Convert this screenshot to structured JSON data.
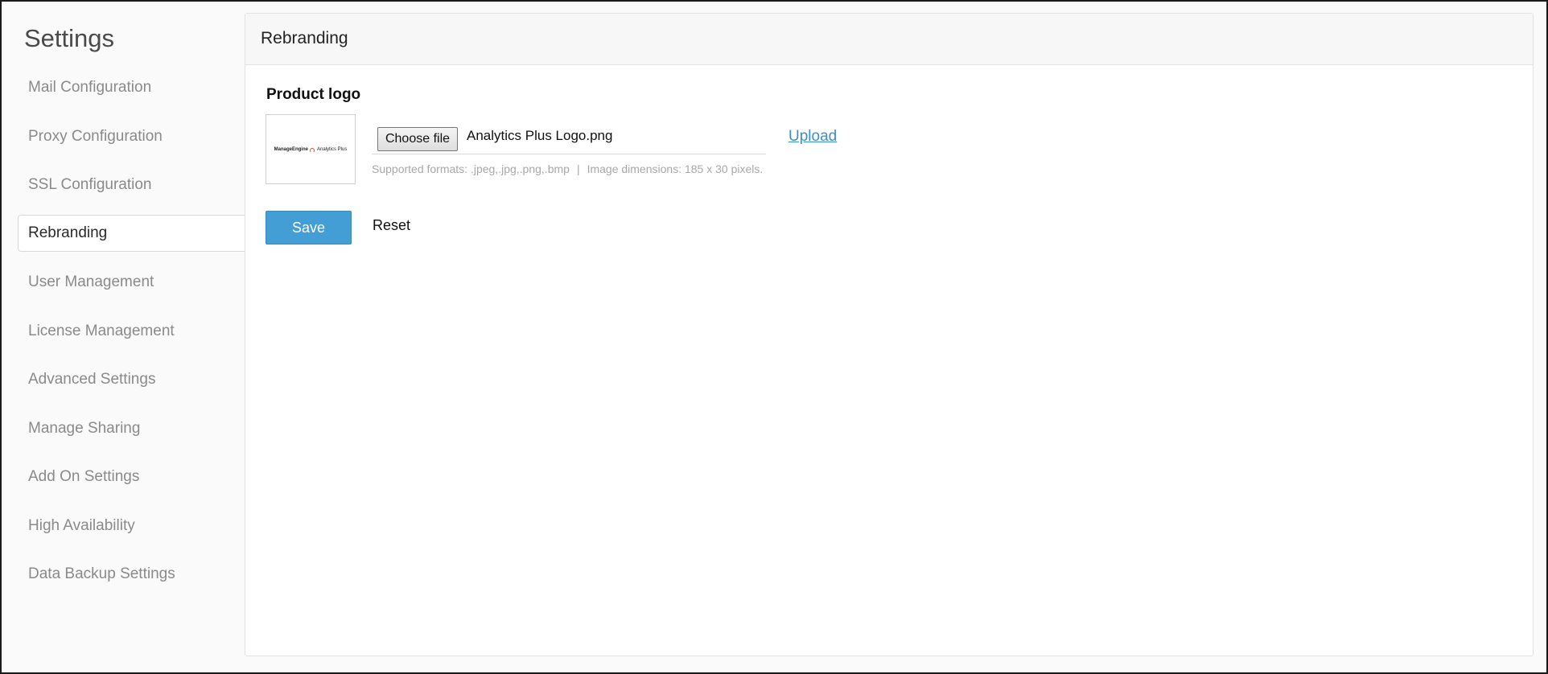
{
  "sidebar": {
    "title": "Settings",
    "items": [
      {
        "label": "Mail Configuration"
      },
      {
        "label": "Proxy Configuration"
      },
      {
        "label": "SSL Configuration"
      },
      {
        "label": "Rebranding",
        "active": true
      },
      {
        "label": "User Management"
      },
      {
        "label": "License Management"
      },
      {
        "label": "Advanced Settings"
      },
      {
        "label": "Manage Sharing"
      },
      {
        "label": "Add On Settings"
      },
      {
        "label": "High Availability"
      },
      {
        "label": "Data Backup Settings"
      }
    ]
  },
  "main": {
    "title": "Rebranding",
    "product_logo": {
      "label": "Product logo",
      "preview": {
        "brand": "ManageEngine",
        "product": "Analytics Plus"
      },
      "choose_file_label": "Choose file",
      "file_name": "Analytics Plus Logo.png",
      "upload_label": "Upload",
      "supported_formats": "Supported formats: .jpeg,.jpg,.png,.bmp",
      "separator": "|",
      "image_dimensions": "Image dimensions: 185 x 30 pixels."
    },
    "actions": {
      "save_label": "Save",
      "reset_label": "Reset"
    }
  },
  "colors": {
    "accent": "#449ed6",
    "link": "#3a8fd0",
    "sidebar_text": "#8a8a8a"
  }
}
